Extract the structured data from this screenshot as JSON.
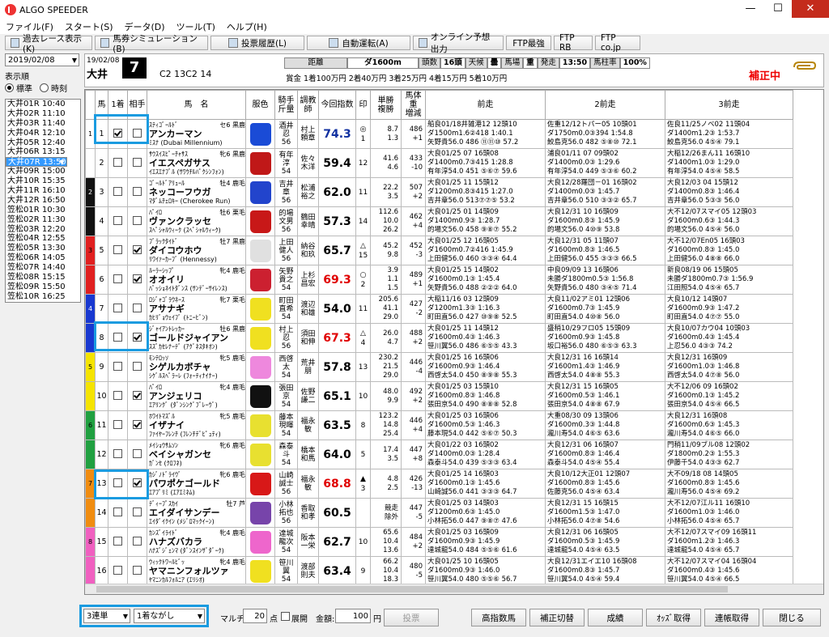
{
  "app": {
    "title": "ALGO SPEEDER",
    "win": {
      "min": "—",
      "max": "☐",
      "close": "✕"
    }
  },
  "menu": [
    "ファイル(F)",
    "スタート(S)",
    "データ(D)",
    "ツール(T)",
    "ヘルプ(H)"
  ],
  "toolbar": [
    "過去レース表示(K)",
    "馬券シミュレーション(B)",
    "投票履歴(L)",
    "自動運転(A)",
    "オンライン予想出力",
    "FTP最強",
    "FTP RB",
    "FTP co.jp"
  ],
  "left": {
    "date": "2019/02/08",
    "sort_label": "表示順",
    "sort_opts": [
      "標準",
      "時刻"
    ],
    "races": [
      "大井01R 10:40",
      "大井02R 11:10",
      "大井03R 11:40",
      "大井04R 12:10",
      "大井05R 12:40",
      "大井06R 13:15",
      "大井07R 13:50",
      "大井08R 14:25",
      "大井09R 15:00",
      "大井10R 15:35",
      "大井11R 16:10",
      "大井12R 16:50",
      "笠松01R 10:30",
      "笠松02R 11:30",
      "笠松03R 12:20",
      "笠松04R 12:55",
      "笠松05R 13:30",
      "笠松06R 14:05",
      "笠松07R 14:40",
      "笠松08R 15:15",
      "笠松09R 15:50",
      "笠松10R 16:25"
    ]
  },
  "header": {
    "date": "19/02/08",
    "venue": "大井",
    "race_no": "7",
    "code": "C2 13C2 14",
    "info": [
      "距離",
      "ダ1600m",
      "頭数",
      "16頭",
      "天候",
      "曇",
      "馬場",
      "重",
      "発走",
      "13:50",
      "馬柱率",
      "100%"
    ],
    "prize": "賞金 1着100万円 2着40万円 3着25万円 4着15万円 5着10万円",
    "hosei": "補正中"
  },
  "cols": [
    "馬",
    "1着",
    "相手",
    "馬　名",
    "服色",
    "騎手\n斤量",
    "調教\n師",
    "今回指数",
    "印",
    "単勝\n複勝",
    "馬体重\n増減",
    "前走",
    "2前走",
    "3前走"
  ],
  "horses": [
    {
      "w": "1",
      "n": "1",
      "c1": true,
      "c2": false,
      "sire": "ｽﾃｨｺﾞｰﾙﾄﾞ",
      "sx": "セ6 黒鹿",
      "name": "アンカーマン",
      "dam": "ﾐｽﾅ (Dubai Millennium)",
      "jk": "酒井\n忍\n56",
      "tr": "村上\n頼章",
      "idx": "74.3",
      "ic": "#1030a0",
      "mk": "◎",
      "mn": "1",
      "od": "8.7\n1.3",
      "wt": "486\n+1",
      "p1": "船良01/18井雑港12 12頭10\nダ1500m1.6②418 1:40.1\n矢野貴56.0 486 ⑪⑪⑩ 57.2",
      "p2": "佐重12/12トパー05 10頭01\nダ1750m0.0③394 1:54.8\n鮫島克56.0 482 ⑤⑧⑩ 72.1",
      "p3": "佐良11/25ノベ02 11頭04\nダ1400m1.2③ 1:53.7\n鮫島克56.0 4⑤④ 79.1",
      "silk": "#1a4bd6"
    },
    {
      "w": "1",
      "n": "2",
      "c1": false,
      "c2": false,
      "sire": "ｻｳｽｲｽﾋﾟｰﾁｬｻｽ",
      "sx": "牝6 黒鹿",
      "name": "イエスペガサス",
      "dam": "ｲｴｽｴﾅﾌﾞﾙ (ｻﾜｳﾁﾙﾊﾟｸｼﾝﾌｫﾝ)",
      "jk": "有年\n淳\n54",
      "tr": "佐々\n木洋",
      "idx": "59.4",
      "ic": "#000",
      "mk": "",
      "mn": "12",
      "od": "41.6\n4.6",
      "wt": "433\n-10",
      "p1": "大良01/25 07 16頭08\nダ1400m0.7③415 1:28.8\n有年淳54.0 451 ⑤⑥⑦ 59.6",
      "p2": "浦良01/11 07 09頭02\nダ1400m0.0③ 1:29.6\n有年淳54.0 449 ⑤③⑥ 60.2",
      "p3": "大稲12/26まん11 16頭10\nダ1400m1.0③ 1:29.0\n有年淳54.0 4⑤④ 58.5",
      "silk": "#c01818"
    },
    {
      "w": "2",
      "n": "3",
      "c1": false,
      "c2": false,
      "sire": "ｺﾞｰﾙﾄﾞｱﾘｭｰﾙ",
      "sx": "牡4 鹿毛",
      "name": "ネッコーフウガ",
      "dam": "ﾏﾀﾞﾑﾁｪﾛｷｰ (Cherokee Run)",
      "jk": "吉井\n章\n56",
      "tr": "松浦\n裕之",
      "idx": "62.0",
      "ic": "#000",
      "mk": "",
      "mn": "11",
      "od": "22.2\n3.5",
      "wt": "507\n+2",
      "p1": "大良01/25 11 15頭12\nダ1200m0.8③415 1:27.0\n吉井章56.0 513⑦⑦⑤ 53.2",
      "p2": "大良12/28羅団－01 16頭02\nダ1400m0.0③ 1:45.7\n吉井章56.0 510 ③③② 65.7",
      "p3": "大良12/03 04 15頭12\nダ1400m0.8③ 1:46.4\n吉井章56.0 5③③ 56.0",
      "silk": "#2244cc"
    },
    {
      "w": "2",
      "n": "4",
      "c1": false,
      "c2": false,
      "sire": "ﾊﾟｲﾛ",
      "sx": "牡6 栗毛",
      "name": "ヴァンクラッセ",
      "dam": "ｽﾍﾟｼｬﾙｳｨｰｸ (ｽﾍﾟｼｬﾙｳｨｰｸ)",
      "jk": "的場\n文男\n56",
      "tr": "鶴田\n幸晴",
      "idx": "57.3",
      "ic": "#000",
      "mk": "",
      "mn": "14",
      "od": "112.6\n10.0\n26.2",
      "wt": "462\n+4",
      "p1": "大良01/25 01 14頭09\nダ1400m0.9③ 1:28.7\n的場文56.0 458 ⑨⑧⑦ 55.2",
      "p2": "大良12/31 10 16頭09\nダ1600m0.8③ 1:45.9\n的場文56.0 4⑩⑨ 53.8",
      "p3": "大不12/07スマイ05 12頭03\nダ1600m0.6③ 1:44.3\n的場文56.0 4⑤④ 56.0",
      "silk": "#c81818"
    },
    {
      "w": "3",
      "n": "5",
      "c1": false,
      "c2": true,
      "sire": "ﾌﾞﾗｯｸﾀｲﾄﾞ",
      "sx": "牡7 黒鹿",
      "name": "ダイコウホウ",
      "dam": "ﾘﾜｲｧｰｶｰﾌﾞ (Hennessy)",
      "jk": "上田\n健人\n56",
      "tr": "納谷\n和玖",
      "idx": "65.7",
      "ic": "#000",
      "mk": "△",
      "mn": "15",
      "od": "45.2\n9.8",
      "wt": "452\n-3",
      "p1": "大良01/25 12 16頭05\nダ1600m0.7②416 1:45.9\n上田健56.0 460 ③③④ 64.4",
      "p2": "大良12/31 05 11頭07\nダ1600m0.8③ 1:46.5\n上田健56.0 455 ③③③ 66.5",
      "p3": "大不12/07En05 16頭03\nダ1600m0.8③ 1:45.0\n上田健56.0 4⑧⑧ 66.0",
      "silk": "#e0e0e0"
    },
    {
      "w": "3",
      "n": "6",
      "c1": false,
      "c2": true,
      "sire": "ﾙｰﾗｰｼｯﾌﾟ",
      "sx": "牝4 鹿毛",
      "name": "オオイリ",
      "dam": "ﾊﾟｯｼｮﾈｲﾄﾀﾞﾝｽ (ｻﾝﾃﾞｰｻｲﾚﾝｽ)",
      "jk": "矢野\n貴之\n54",
      "tr": "上杉\n昌宏",
      "idx": "69.3",
      "ic": "#e00000",
      "mk": "○",
      "mn": "2",
      "od": "3.9\n1.1\n1.5",
      "wt": "489\n+1",
      "p1": "大良01/25 15 14頭02\nダ1600m0.1③ 1:45.4\n矢野貴56.0 488 ②②② 64.0",
      "p2": "中良09/09 13 16頭06\n未勝ダ1800m0.5③ 1:56.8\n矢野貴56.0 480 ③④⑤ 71.4",
      "p3": "新良08/19 06 15頭05\n未勝ダ1800m0.7③ 1:56.9\n江田照54.0 4⑤④ 65.7",
      "silk": "#cc2030"
    },
    {
      "w": "4",
      "n": "7",
      "c1": false,
      "c2": false,
      "sire": "ﾛｼﾞｬｺﾞﾗｳﾈｰｽ",
      "sx": "牝7 栗毛",
      "name": "アサナギ",
      "dam": "ｶﾋﾘﾞｮｳｪｲﾌﾞ (ﾄﾆｰﾋﾞﾝ)",
      "jk": "町田\n直希\n54",
      "tr": "渡辺\n和雄",
      "idx": "54.0",
      "ic": "#000",
      "mk": "",
      "mn": "11",
      "od": "205.6\n41.1\n29.0",
      "wt": "427\n-2",
      "p1": "大稲11/16 03 12頭09\nダ1200m1.3③ 1:16.3\n町田直56.0 427 ⑩⑨⑧ 52.5",
      "p2": "大良11/02アミ01 12頭06\nダ1600m0.7③ 1:45.9\n町田直54.0 4⑩⑧ 56.0",
      "p3": "大良10/12 14頭07\nダ1600m0.9③ 1:47.2\n町田直54.0 4⑦⑦ 55.0",
      "silk": "#f0e020"
    },
    {
      "w": "4",
      "n": "8",
      "c1": false,
      "c2": true,
      "sire": "ｼﾞｬｲｱﾝﾄﾚｯｶｰ",
      "sx": "牡6 黒鹿",
      "name": "ゴールドジャイアン",
      "dam": "ｽｽﾞｶｾﾚﾅｰﾃﾞ (ｱｸﾞﾈｽﾀｷｵﾝ)",
      "jk": "村上\n忍\n56",
      "tr": "須田\n和伸",
      "idx": "67.3",
      "ic": "#e00000",
      "mk": "△",
      "mn": "4",
      "od": "26.0\n4.7",
      "wt": "488\n+2",
      "p1": "大良01/25 11 14頭12\nダ1600m0.4③ 1:46.3\n笹川翼56.0 486 ⑥⑤⑤ 43.3",
      "p2": "盛稍10/29フロ05 15頭09\nダ1600m0.9③ 1:45.8\n坂口裕56.0 480 ⑥⑤③ 63.3",
      "p3": "大良10/07カウ04 10頭03\nダ1600m0.4③ 1:45.4\n上忍56.0 4③③ 74.2",
      "silk": "#f0e020"
    },
    {
      "w": "5",
      "n": "9",
      "c1": false,
      "c2": false,
      "sire": "ﾓﾝﾃﾛｯｿ",
      "sx": "牝5 鹿毛",
      "name": "シゲルカボチャ",
      "dam": "ｼｹﾞﾙｽﾍﾟﾗｰﾚ (ﾌｫｰﾃｨﾅｲﾅｰ)",
      "jk": "西啓\n太\n54",
      "tr": "荒井\n朋",
      "idx": "57.8",
      "ic": "#000",
      "mk": "",
      "mn": "13",
      "od": "230.2\n21.5\n29.0",
      "wt": "446\n-4",
      "p1": "大良01/25 16 16頭06\nダ1600m0.9③ 1:46.4\n西啓太54.0 450 ⑧⑨⑧ 55.3",
      "p2": "大良12/31 16 16頭14\nダ1600m1.4③ 1:46.9\n西啓太54.0 4⑧⑧ 55.3",
      "p3": "大良12/31 16頭09\nダ1600m1.0③ 1:46.8\n西啓太54.0 4⑦⑧ 56.0",
      "silk": "#ee88dd"
    },
    {
      "w": "5",
      "n": "10",
      "c1": false,
      "c2": true,
      "sire": "ﾊﾟｲﾛ",
      "sx": "牝4 鹿毛",
      "name": "アンジェリコ",
      "dam": "ｴｱﾘﾝｸﾞ (ﾀﾞﾝｼﾝｸﾞﾌﾞﾚｰｳﾞ)",
      "jk": "張田\n京\n54",
      "tr": "佐野\n謙二",
      "idx": "65.1",
      "ic": "#000",
      "mk": "",
      "mn": "10",
      "od": "48.0\n9.9",
      "wt": "492\n+2",
      "p1": "大良01/25 03 15頭10\nダ1600m0.8③ 1:46.8\n張田京54.0 490 ⑧⑧⑧ 52.8",
      "p2": "大良12/31 15 16頭05\nダ1600m0.5③ 1:46.1\n張田京54.0 4⑧⑧ 67.9",
      "p3": "大不12/06 09 16頭02\nダ1600m0.1③ 1:45.2\n張田京54.0 4⑤④ 66.5",
      "silk": "#111111"
    },
    {
      "w": "6",
      "n": "11",
      "c1": false,
      "c2": true,
      "sire": "ﾎﾜｲﾄﾏｽﾞﾙ",
      "sx": "牝5 鹿毛",
      "name": "イザナイ",
      "dam": "ﾌｧｲﾔｰﾌﾚﾝﾁ (ﾌﾚﾝﾁﾃﾞﾋﾟｭﾃｨ)",
      "jk": "藤本\n現暉\n54",
      "tr": "福永\n敏",
      "idx": "63.5",
      "ic": "#000",
      "mk": "",
      "mn": "8",
      "od": "123.2\n14.8\n25.4",
      "wt": "446\n+4",
      "p1": "大良01/25 03 16頭06\nダ1600m0.5③ 1:46.3\n藤本現54.0 442 ⑤⑥⑦ 50.3",
      "p2": "大重08/30 09 13頭06\nダ1600m0.3③ 1:44.8\n瀧川寿54.0 4⑥⑤ 63.6",
      "p3": "大良12/31 16頭08\nダ1600m0.6③ 1:45.3\n瀧川寿54.0 4⑥⑤ 66.0",
      "silk": "#e8e030"
    },
    {
      "w": "6",
      "n": "12",
      "c1": false,
      "c2": false,
      "sire": "ﾒｲｼｮｳｻﾑｿﾝ",
      "sx": "牝6 鹿毛",
      "name": "ベイシャガンセ",
      "dam": "ｶﾞﾝｾ (ｸﾛﾌﾈ)",
      "jk": "森泰\n斗\n54",
      "tr": "橋本\n和馬",
      "idx": "64.0",
      "ic": "#000",
      "mk": "",
      "mn": "5",
      "od": "17.4\n3.5",
      "wt": "447\n+8",
      "p1": "大良01/22 03 16頭02\nダ1400m0.0③ 1:28.4\n森泰斗54.0 439 ⑤③③ 63.4",
      "p2": "大良12/31 06 16頭07\nダ1600m0.8③ 1:46.4\n森泰斗54.0 4⑤④ 55.4",
      "p3": "門稍11/09ブル08 12頭02\nダ1800m0.2③ 1:55.3\n伊藤千54.0 4③③ 62.7",
      "silk": "#e8e030"
    },
    {
      "w": "7",
      "n": "13",
      "c1": false,
      "c2": true,
      "sire": "ｶｼﾞﾉﾄﾞﾗｲｳﾞ",
      "sx": "牝6 鹿毛",
      "name": "パワポケゴールド",
      "dam": "ｴｱﾌﾟﾘﾐ (ｴｱｴﾐﾈﾑ)",
      "jk": "山崎\n誠士\n56",
      "tr": "福永\n敏",
      "idx": "68.8",
      "ic": "#e00000",
      "mk": "▲",
      "mn": "3",
      "od": "4.8\n2.5",
      "wt": "426\n-13",
      "p1": "大良01/25 14 16頭03\nダ1600m0.1③ 1:45.6\n山崎誠56.0 441 ③③③ 64.7",
      "p2": "大良10/12大正01 12頭07\nダ1600m0.8③ 1:45.6\n佐藤克56.0 4⑤④ 63.4",
      "p3": "大不09/18 08 14頭05\nダ1600m0.8③ 1:45.6\n瀧川寿56.0 4⑤④ 69.2",
      "silk": "#d81818"
    },
    {
      "w": "7",
      "n": "14",
      "c1": false,
      "c2": false,
      "sire": "ﾃﾞｨｰﾌﾟｽｶｲ",
      "sx": "牡7 芦",
      "name": "エイダイサンデー",
      "dam": "ｴｲﾀﾞｲｸｲﾝ (ﾒｼﾞﾛﾏｯｸｲｰﾝ)",
      "jk": "小林\n拓也\n56",
      "tr": "香取\n和孝",
      "idx": "60.5",
      "ic": "#000",
      "mk": "",
      "mn": "",
      "od": "競走\n除外",
      "wt": "447\n-5",
      "p1": "大良01/25 03 14頭03\nダ1200m0.6③ 1:45.0\n小林拓56.0 447 ⑨⑧⑦ 47.6",
      "p2": "大良12/31 15 16頭15\nダ1600m1.5③ 1:47.0\n小林拓56.0 4⑦⑧ 54.6",
      "p3": "大不12/07江ル11 16頭10\nダ1600m1.0③ 1:46.0\n小林拓56.0 4⑤④ 65.7",
      "silk": "#7744aa"
    },
    {
      "w": "8",
      "n": "15",
      "c1": false,
      "c2": false,
      "sire": "ｶﾝｽﾞｲﾗｲﾄﾞ",
      "sx": "牝4 鹿毛",
      "name": "ハナズバカラ",
      "dam": "ﾊﾅｽﾞｼﾞｪﾝﾏ (ﾀﾞﾝｽｲﾝｻﾞﾀﾞｰｸ)",
      "jk": "達城\n龍次\n54",
      "tr": "阪本\n一栄",
      "idx": "62.7",
      "ic": "#000",
      "mk": "",
      "mn": "10",
      "od": "65.6\n10.4\n13.6",
      "wt": "484\n+2",
      "p1": "大良01/25 03 16頭09\nダ1600m0.9③ 1:45.9\n達城龍54.0 484 ⑤⑤⑥ 61.6",
      "p2": "大良12/31 06 16頭05\nダ1600m0.5③ 1:45.9\n達城龍54.0 4⑤④ 63.5",
      "p3": "大不12/07スマイ09 16頭11\nダ1600m1.2③ 1:46.3\n達城龍54.0 4⑤④ 65.7",
      "silk": "#ee66cc"
    },
    {
      "w": "8",
      "n": "16",
      "c1": false,
      "c2": false,
      "sire": "ｳｨｯｸﾄﾜｰﾙﾋﾞｯ",
      "sx": "牝4 鹿毛",
      "name": "ヤマニンフォルツァ",
      "dam": "ﾔﾏﾆﾝｶﾙﾌｫﾙﾆｱ (ｴﾘｼｵ)",
      "jk": "笹川\n翼\n54",
      "tr": "渡部\n則夫",
      "idx": "63.4",
      "ic": "#000",
      "mk": "",
      "mn": "9",
      "od": "66.2\n10.4\n18.3",
      "wt": "480\n-5",
      "p1": "大良01/25 10 16頭05\nダ1600m0.9③ 1:46.0\n笹川翼54.0 480 ⑤⑤⑥ 56.7",
      "p2": "大良12/31エイエ10 16頭08\nダ1600m0.8③ 1:45.7\n笹川翼54.0 4⑤④ 59.4",
      "p3": "大不12/07スマイ04 16頭04\nダ1600m0.4③ 1:45.6\n笹川翼54.0 4⑤④ 66.5",
      "silk": "#f0e020"
    }
  ],
  "wakucolors": {
    "1": "#ffffff",
    "2": "#111111",
    "3": "#e02020",
    "4": "#1838d0",
    "5": "#f5e400",
    "6": "#20a040",
    "7": "#f08c10",
    "8": "#f060c0"
  },
  "bottom": {
    "bet": "3連単",
    "mode": "1着ながし",
    "multi": "マルチ",
    "points": "20",
    "points_unit": "点",
    "expand": "展開",
    "amt_label": "金額:",
    "amount": "100",
    "yen": "円",
    "vote": "投票",
    "btns": [
      "高指数馬",
      "補正切替",
      "成績",
      "ｵｯｽﾞ取得",
      "連帳取得",
      "閉じる"
    ]
  }
}
